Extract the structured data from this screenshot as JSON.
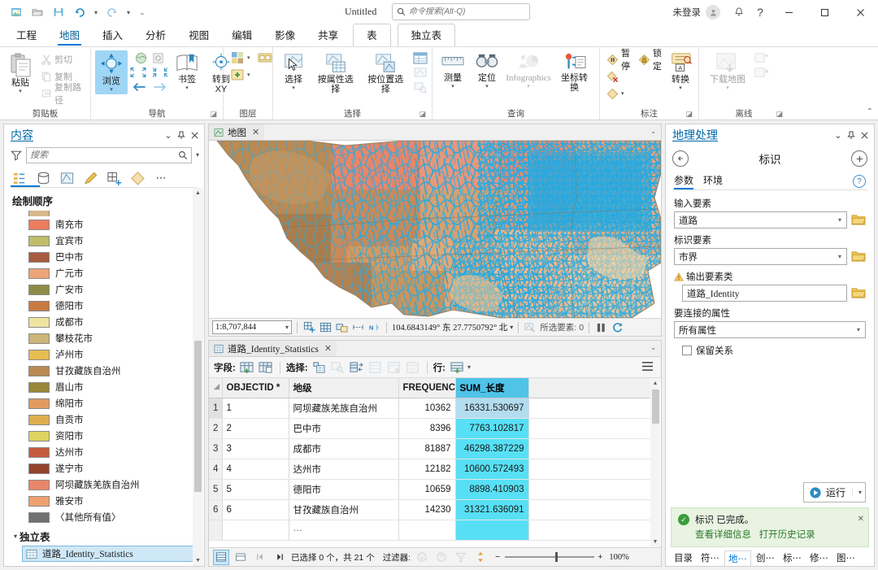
{
  "titlebar": {
    "document_title": "Untitled",
    "search_placeholder": "命令搜索(Alt-Q)",
    "account_label": "未登录",
    "quick_access": [
      {
        "name": "new-project-icon"
      },
      {
        "name": "open-project-icon"
      },
      {
        "name": "save-project-icon"
      },
      {
        "name": "undo-icon"
      },
      {
        "name": "redo-icon"
      },
      {
        "name": "customize-qat-icon"
      }
    ],
    "window_buttons": {
      "minimize": "—",
      "maximize": "□",
      "close": "✕"
    },
    "help_label": "?"
  },
  "ribbon": {
    "tabs": [
      {
        "label": "工程",
        "active": false,
        "context": false
      },
      {
        "label": "地图",
        "active": true,
        "context": false
      },
      {
        "label": "插入",
        "active": false,
        "context": false
      },
      {
        "label": "分析",
        "active": false,
        "context": false
      },
      {
        "label": "视图",
        "active": false,
        "context": false
      },
      {
        "label": "编辑",
        "active": false,
        "context": false
      },
      {
        "label": "影像",
        "active": false,
        "context": false
      },
      {
        "label": "共享",
        "active": false,
        "context": false
      },
      {
        "label": "表",
        "active": false,
        "context": true
      },
      {
        "label": "独立表",
        "active": true,
        "context": true
      }
    ],
    "groups": [
      {
        "label": "剪贴板",
        "big": [
          {
            "label": "粘贴",
            "dropdown": true,
            "disabled": false
          }
        ],
        "small": [
          {
            "label": "剪切",
            "disabled": true
          },
          {
            "label": "复制",
            "disabled": true
          },
          {
            "label": "复制路径",
            "disabled": true
          }
        ]
      },
      {
        "label": "导航",
        "big": [
          {
            "label": "浏览",
            "dropdown": true,
            "selected": true
          },
          {
            "label": "书签",
            "dropdown": true
          },
          {
            "label": "转到\nXY",
            "dropdown": false
          }
        ],
        "dialog_launcher": true
      },
      {
        "label": "图层",
        "big": [],
        "small": []
      },
      {
        "label": "选择",
        "big": [
          {
            "label": "选择",
            "dropdown": true
          },
          {
            "label": "按属性选择",
            "dropdown": false
          },
          {
            "label": "按位置选择",
            "dropdown": false
          }
        ],
        "dialog_launcher": true
      },
      {
        "label": "查询",
        "big": [
          {
            "label": "测量",
            "dropdown": true
          },
          {
            "label": "定位",
            "dropdown": true
          },
          {
            "label": "Infographics",
            "dropdown": true,
            "disabled": true
          },
          {
            "label": "坐标转换",
            "dropdown": false
          }
        ]
      },
      {
        "label": "标注",
        "big": [
          {
            "label": "转换",
            "dropdown": true
          }
        ],
        "small": [
          {
            "label": "暂停",
            "disabled": false
          },
          {
            "label": "锁定",
            "disabled": false
          }
        ],
        "dialog_launcher": true
      },
      {
        "label": "离线",
        "big": [
          {
            "label": "下载地图",
            "dropdown": true,
            "disabled": true
          }
        ],
        "dialog_launcher": true
      }
    ]
  },
  "contents": {
    "title": "内容",
    "search_placeholder": "搜索",
    "section_title": "绘制顺序",
    "legend_items": [
      {
        "label": "",
        "color": "#d7b98a",
        "clipped": true
      },
      {
        "label": "南充市",
        "color": "#ec7d5e"
      },
      {
        "label": "宜宾市",
        "color": "#c1bc6a"
      },
      {
        "label": "巴中市",
        "color": "#a85a3f"
      },
      {
        "label": "广元市",
        "color": "#eda578"
      },
      {
        "label": "广安市",
        "color": "#8e8b46"
      },
      {
        "label": "德阳市",
        "color": "#c97a42"
      },
      {
        "label": "成都市",
        "color": "#efe3a0"
      },
      {
        "label": "攀枝花市",
        "color": "#cdb477"
      },
      {
        "label": "泸州市",
        "color": "#e7bd51"
      },
      {
        "label": "甘孜藏族自治州",
        "color": "#b98a54"
      },
      {
        "label": "眉山市",
        "color": "#97883a"
      },
      {
        "label": "绵阳市",
        "color": "#e29a5e"
      },
      {
        "label": "自贡市",
        "color": "#ddae4f"
      },
      {
        "label": "资阳市",
        "color": "#ddd461"
      },
      {
        "label": "达州市",
        "color": "#c75b3e"
      },
      {
        "label": "遂宁市",
        "color": "#93432c"
      },
      {
        "label": "阿坝藏族羌族自治州",
        "color": "#ea8668"
      },
      {
        "label": "雅安市",
        "color": "#f0a070"
      },
      {
        "label": "〈其他所有值〉",
        "color": "#707070"
      }
    ],
    "standalone_section": "独立表",
    "standalone_table": "道路_Identity_Statistics"
  },
  "mapview": {
    "tab_label": "地图",
    "scale": "1:8,707,844",
    "coordinates": "104.6843149° 东  27.7750792° 北",
    "selected_features_label": "所选要素:",
    "selected_features_count": "0"
  },
  "tableview": {
    "tab_label": "道路_Identity_Statistics",
    "toolbar": {
      "fields_label": "字段:",
      "select_label": "选择:",
      "rows_label": "行:"
    },
    "columns": [
      "OBJECTID *",
      "地级",
      "FREQUENCY",
      "SUM_长度"
    ],
    "highlighted_column": "SUM_长度",
    "rows": [
      {
        "n": "1",
        "objectid": "1",
        "name": "阿坝藏族羌族自治州",
        "frequency": "10362",
        "sum": "16331.530697"
      },
      {
        "n": "2",
        "objectid": "2",
        "name": "巴中市",
        "frequency": "8396",
        "sum": "7763.102817"
      },
      {
        "n": "3",
        "objectid": "3",
        "name": "成都市",
        "frequency": "81887",
        "sum": "46298.387229"
      },
      {
        "n": "4",
        "objectid": "4",
        "name": "达州市",
        "frequency": "12182",
        "sum": "10600.572493"
      },
      {
        "n": "5",
        "objectid": "5",
        "name": "德阳市",
        "frequency": "10659",
        "sum": "8898.410903"
      },
      {
        "n": "6",
        "objectid": "6",
        "name": "甘孜藏族自治州",
        "frequency": "14230",
        "sum": "31321.636091"
      }
    ],
    "status": {
      "selection_text": "已选择 0 个，共 21 个",
      "filter_label": "过滤器:",
      "zoom_level": "100%"
    }
  },
  "geoprocessing": {
    "title": "地理处理",
    "tool_name": "标识",
    "tabs": [
      {
        "label": "参数",
        "active": true
      },
      {
        "label": "环境",
        "active": false
      }
    ],
    "fields": [
      {
        "label": "输入要素",
        "value": "道路",
        "type": "combo",
        "browse": true,
        "warning": false
      },
      {
        "label": "标识要素",
        "value": "市界",
        "type": "combo",
        "browse": true,
        "warning": false,
        "indent": true
      },
      {
        "label": "输出要素类",
        "value": "道路_Identity",
        "type": "text",
        "browse": true,
        "warning": true
      },
      {
        "label": "要连接的属性",
        "value": "所有属性",
        "type": "combo",
        "browse": false,
        "warning": false
      }
    ],
    "checkbox": {
      "label": "保留关系",
      "checked": false
    },
    "run_button": "运行",
    "message": {
      "line1": "标识 已完成。",
      "link1": "查看详细信息",
      "link2": "打开历史记录"
    },
    "dock_tabs": [
      {
        "label": "目录",
        "active": false
      },
      {
        "label": "符⋯",
        "active": false
      },
      {
        "label": "地⋯",
        "active": true
      },
      {
        "label": "创⋯",
        "active": false
      },
      {
        "label": "标⋯",
        "active": false
      },
      {
        "label": "修⋯",
        "active": false
      },
      {
        "label": "图⋯",
        "active": false
      }
    ]
  },
  "colors": {
    "accent": "#0078d4",
    "panel_title": "#0069a8",
    "table_highlight": "#57e0f5",
    "road_line": "#27aae1",
    "success": "#3a9c3a"
  }
}
